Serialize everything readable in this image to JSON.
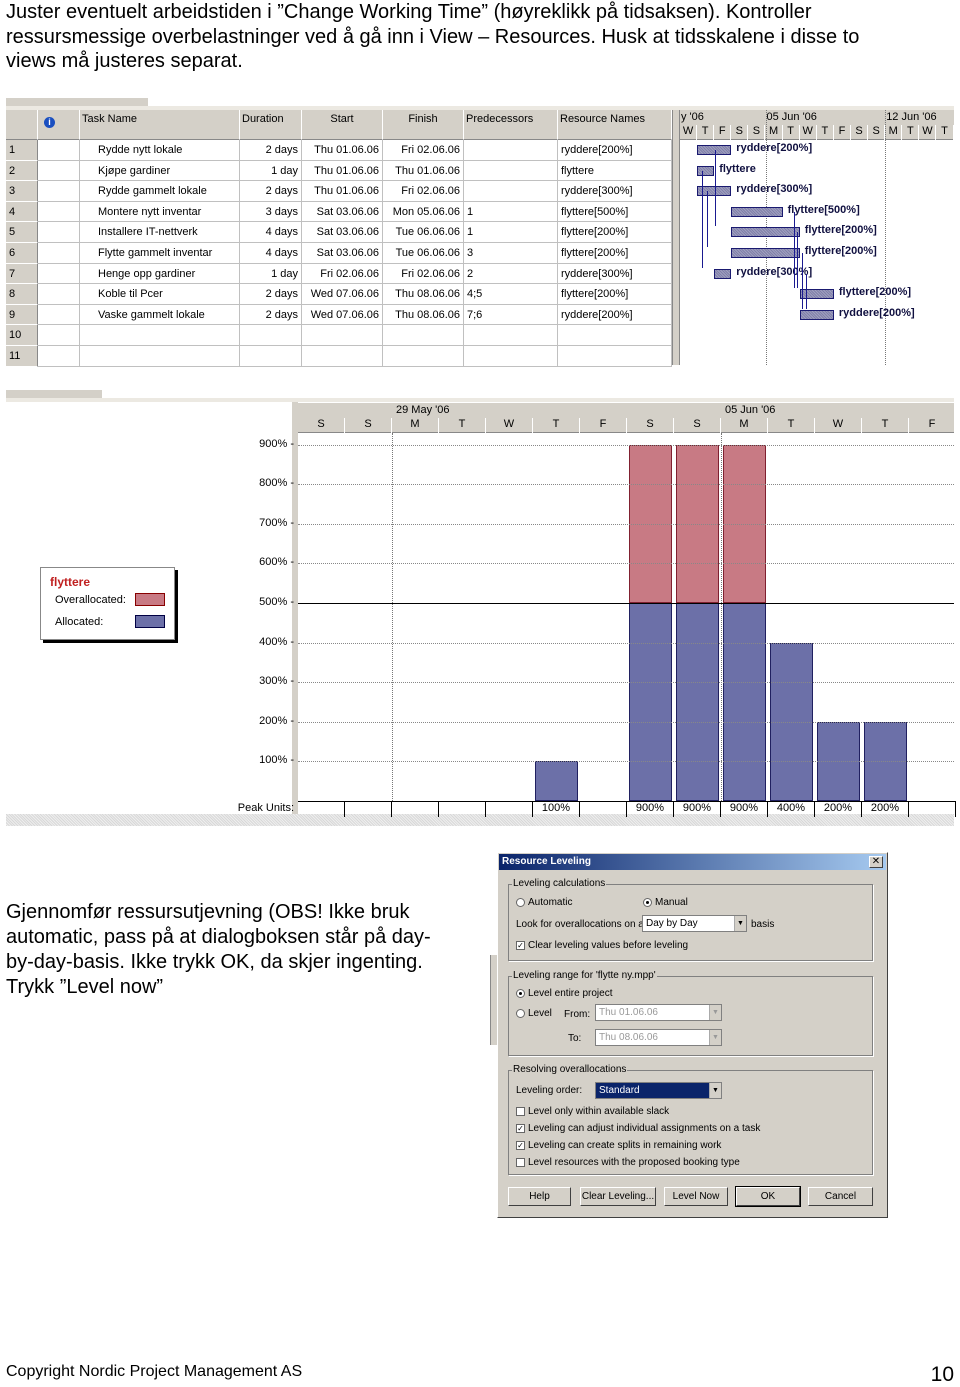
{
  "intro": [
    "Juster eventuelt arbeidstiden i ”Change Working Time” (høyreklikk på tidsaksen). Kontroller",
    "ressursmessige overbelastninger ved å gå inn i View – Resources. Husk at tidsskalene i disse to",
    "views må justeres separat."
  ],
  "gantt": {
    "headers": {
      "info": "info-icon",
      "task": "Task Name",
      "duration": "Duration",
      "start": "Start",
      "finish": "Finish",
      "pred": "Predecessors",
      "res": "Resource Names"
    },
    "timescale_top": [
      "y '06",
      "05 Jun '06",
      "12 Jun '06"
    ],
    "timescale_days": [
      "W",
      "T",
      "F",
      "S",
      "S",
      "M",
      "T",
      "W",
      "T",
      "F",
      "S",
      "S",
      "M",
      "T",
      "W",
      "T"
    ],
    "rows": [
      {
        "id": "1",
        "name": "Rydde nytt lokale",
        "duration": "2 days",
        "start": "Thu 01.06.06",
        "finish": "Fri 02.06.06",
        "pred": "",
        "res": "ryddere[200%]"
      },
      {
        "id": "2",
        "name": "Kjøpe gardiner",
        "duration": "1 day",
        "start": "Thu 01.06.06",
        "finish": "Thu 01.06.06",
        "pred": "",
        "res": "flyttere"
      },
      {
        "id": "3",
        "name": "Rydde gammelt lokale",
        "duration": "2 days",
        "start": "Thu 01.06.06",
        "finish": "Fri 02.06.06",
        "pred": "",
        "res": "ryddere[300%]"
      },
      {
        "id": "4",
        "name": "Montere nytt inventar",
        "duration": "3 days",
        "start": "Sat 03.06.06",
        "finish": "Mon 05.06.06",
        "pred": "1",
        "res": "flyttere[500%]"
      },
      {
        "id": "5",
        "name": "Installere IT-nettverk",
        "duration": "4 days",
        "start": "Sat 03.06.06",
        "finish": "Tue 06.06.06",
        "pred": "1",
        "res": "flyttere[200%]"
      },
      {
        "id": "6",
        "name": "Flytte gammelt inventar",
        "duration": "4 days",
        "start": "Sat 03.06.06",
        "finish": "Tue 06.06.06",
        "pred": "3",
        "res": "flyttere[200%]"
      },
      {
        "id": "7",
        "name": "Henge opp gardiner",
        "duration": "1 day",
        "start": "Fri 02.06.06",
        "finish": "Fri 02.06.06",
        "pred": "2",
        "res": "ryddere[300%]"
      },
      {
        "id": "8",
        "name": "Koble til Pcer",
        "duration": "2 days",
        "start": "Wed 07.06.06",
        "finish": "Thu 08.06.06",
        "pred": "4;5",
        "res": "flyttere[200%]"
      },
      {
        "id": "9",
        "name": "Vaske gammelt lokale",
        "duration": "2 days",
        "start": "Wed 07.06.06",
        "finish": "Thu 08.06.06",
        "pred": "7;6",
        "res": "ryddere[200%]"
      },
      {
        "id": "10",
        "name": "",
        "duration": "",
        "start": "",
        "finish": "",
        "pred": "",
        "res": ""
      },
      {
        "id": "11",
        "name": "",
        "duration": "",
        "start": "",
        "finish": "",
        "pred": "",
        "res": ""
      }
    ],
    "bar_color": "#8c8cb4"
  },
  "graph": {
    "legend": {
      "resource": "flyttere",
      "over": "Overallocated:",
      "alloc": "Allocated:"
    },
    "weeks": [
      "29 May '06",
      "05 Jun '06"
    ],
    "peak_label": "Peak Units:",
    "colors": {
      "over": "#c87a84",
      "alloc": "#6c70a8"
    },
    "chart_data": {
      "type": "bar",
      "categories": [
        "S",
        "S",
        "M",
        "T",
        "W",
        "T",
        "F",
        "S",
        "S",
        "M",
        "T",
        "W",
        "T",
        "F"
      ],
      "values": [
        0,
        0,
        0,
        0,
        0,
        100,
        0,
        900,
        900,
        900,
        400,
        200,
        200,
        0
      ],
      "peak_units": [
        "",
        "",
        "",
        "",
        "",
        "100%",
        "",
        "900%",
        "900%",
        "900%",
        "400%",
        "200%",
        "200%",
        ""
      ],
      "yticks": [
        "900%",
        "800%",
        "700%",
        "600%",
        "500%",
        "400%",
        "300%",
        "200%",
        "100%"
      ],
      "ylim": [
        0,
        900
      ],
      "max_units": 500,
      "grid": true
    }
  },
  "body": [
    "Gjennomfør ressursutjevning (OBS! Ikke bruk",
    "automatic, pass på at dialogboksen står på day-",
    "by-day-basis. Ikke trykk OK, da skjer ingenting.",
    "Trykk ”Level now”"
  ],
  "dialog": {
    "title": "Resource Leveling",
    "g1": "Leveling calculations",
    "automatic": "Automatic",
    "manual": "Manual",
    "look": "Look for overallocations on a",
    "basis_value": "Day by Day",
    "basis": "basis",
    "clear": "Clear leveling values before leveling",
    "g2": "Leveling range for 'flytte ny.mpp'",
    "entire": "Level entire project",
    "level": "Level",
    "from": "From:",
    "from_value": "Thu 01.06.06",
    "to": "To:",
    "to_value": "Thu 08.06.06",
    "g3": "Resolving overallocations",
    "order": "Leveling order:",
    "order_value": "Standard",
    "opts": [
      {
        "label": "Level only within available slack",
        "checked": false
      },
      {
        "label": "Leveling can adjust individual assignments on a task",
        "checked": true
      },
      {
        "label": "Leveling can create splits in remaining work",
        "checked": true
      },
      {
        "label": "Level resources with the proposed booking type",
        "checked": false
      }
    ],
    "buttons": {
      "help": "Help",
      "clear": "Clear Leveling...",
      "level_now": "Level Now",
      "ok": "OK",
      "cancel": "Cancel"
    }
  },
  "footer": {
    "copyright": "Copyright Nordic Project Management AS",
    "page": "10"
  }
}
